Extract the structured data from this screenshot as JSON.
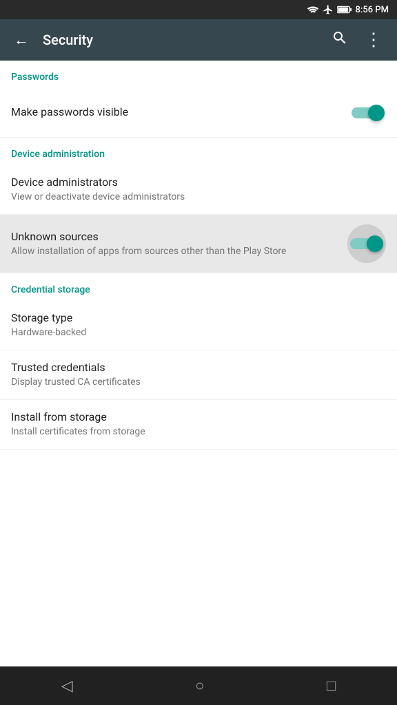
{
  "statusBar": {
    "time": "8:56 PM"
  },
  "appBar": {
    "title": "Security",
    "backLabel": "←",
    "searchLabel": "⚲",
    "moreLabel": "⋮"
  },
  "sections": [
    {
      "id": "passwords",
      "header": "Passwords",
      "items": [
        {
          "id": "make-passwords-visible",
          "title": "Make passwords visible",
          "subtitle": "",
          "hasToggle": true,
          "toggleOn": true,
          "highlighted": false
        }
      ]
    },
    {
      "id": "device-administration",
      "header": "Device administration",
      "items": [
        {
          "id": "device-administrators",
          "title": "Device administrators",
          "subtitle": "View or deactivate device administrators",
          "hasToggle": false,
          "highlighted": false
        },
        {
          "id": "unknown-sources",
          "title": "Unknown sources",
          "subtitle": "Allow installation of apps from sources other than the Play Store",
          "hasToggle": true,
          "toggleOn": true,
          "highlighted": true
        }
      ]
    },
    {
      "id": "credential-storage",
      "header": "Credential storage",
      "items": [
        {
          "id": "storage-type",
          "title": "Storage type",
          "subtitle": "Hardware-backed",
          "hasToggle": false,
          "highlighted": false
        },
        {
          "id": "trusted-credentials",
          "title": "Trusted credentials",
          "subtitle": "Display trusted CA certificates",
          "hasToggle": false,
          "highlighted": false
        },
        {
          "id": "install-from-storage",
          "title": "Install from storage",
          "subtitle": "Install certificates from storage",
          "hasToggle": false,
          "highlighted": false
        }
      ]
    }
  ],
  "bottomNav": {
    "back": "◁",
    "home": "○",
    "recent": "□"
  }
}
